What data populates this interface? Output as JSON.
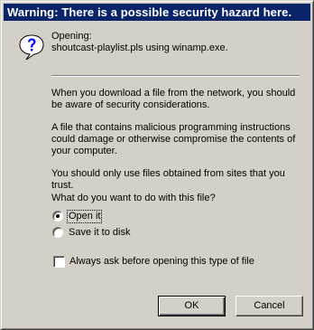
{
  "dialog": {
    "title": "Warning:  There is a possible security hazard here.",
    "icon": "question-icon",
    "opening_label": "Opening:",
    "opening_file": "shoutcast-playlist.pls using winamp.exe.",
    "paragraphs": [
      "When you download a file from the network, you should be aware of security considerations.",
      "A file that contains malicious programming instructions could damage or otherwise compromise the contents of your computer.",
      "You should only use files obtained from sites that you trust."
    ],
    "question": "What do you want to do with this file?",
    "options": [
      {
        "label": "Open it",
        "checked": true
      },
      {
        "label": "Save it to disk",
        "checked": false
      }
    ],
    "always_ask": {
      "label": "Always ask before opening this type of file",
      "checked": false
    },
    "buttons": {
      "ok": "OK",
      "cancel": "Cancel"
    }
  },
  "colors": {
    "titlebar": "#0a246a",
    "face": "#d4d0c8",
    "icon_blue": "#0000ff"
  }
}
